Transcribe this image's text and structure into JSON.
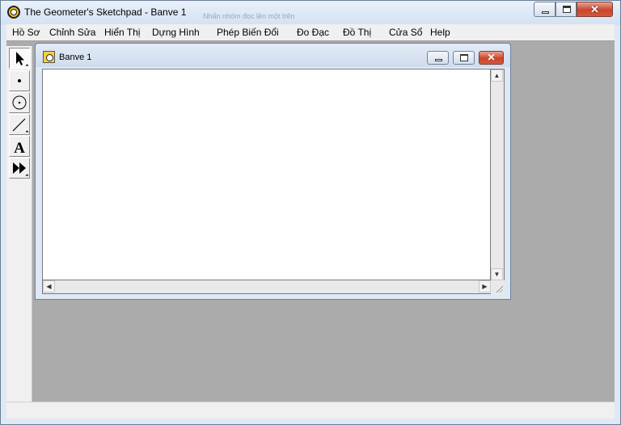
{
  "window": {
    "title": "The Geometer's Sketchpad - Banve 1",
    "ghost_text": "Nhấn nhóm đọc lên một trên"
  },
  "caption_buttons": {
    "minimize": "minimize-icon",
    "maximize": "maximize-icon",
    "close": "✕"
  },
  "menu": {
    "items": [
      {
        "label": "Hồ Sơ"
      },
      {
        "label": "Chỉnh Sửa"
      },
      {
        "label": "Hiển Thị"
      },
      {
        "label": "Dựng Hình"
      },
      {
        "label": "Phép Biến Đổi"
      },
      {
        "label": "Đo Đạc"
      },
      {
        "label": "Đồ Thị"
      },
      {
        "label": "Cửa Sổ"
      },
      {
        "label": "Help"
      }
    ]
  },
  "toolbox": {
    "tools": [
      {
        "name": "selection-arrow-tool",
        "icon": "arrow-icon"
      },
      {
        "name": "point-tool",
        "icon": "point-icon"
      },
      {
        "name": "compass-tool",
        "icon": "circle-icon"
      },
      {
        "name": "straightedge-tool",
        "icon": "segment-icon"
      },
      {
        "name": "text-tool",
        "icon": "text-icon",
        "glyph": "A"
      },
      {
        "name": "custom-tool",
        "icon": "fast-forward-icon"
      }
    ]
  },
  "document": {
    "title": "Banve 1",
    "close_glyph": "✕"
  },
  "scrollbars": {
    "up": "▲",
    "down": "▼",
    "left": "◀",
    "right": "▶"
  },
  "colors": {
    "client_background": "#ababab",
    "close_button": "#c9462c"
  }
}
